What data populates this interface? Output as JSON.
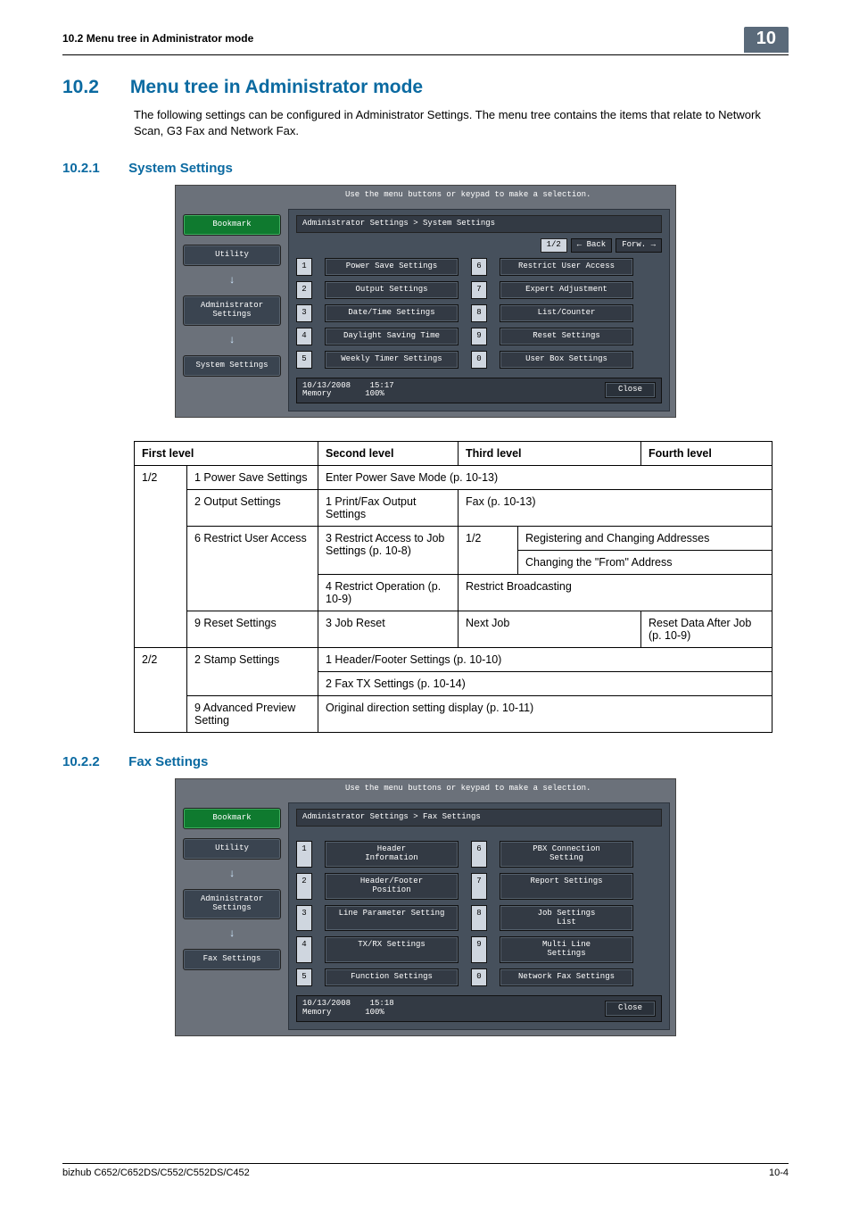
{
  "header": {
    "running_title": "10.2    Menu tree in Administrator mode",
    "chapter_badge": "10"
  },
  "section": {
    "number": "10.2",
    "title": "Menu tree in Administrator mode",
    "intro": "The following settings can be configured in Administrator Settings. The menu tree contains the items that relate to Network Scan, G3 Fax and Network Fax."
  },
  "sub1": {
    "number": "10.2.1",
    "title": "System Settings",
    "panel": {
      "hint": "Use the menu buttons or keypad to make a selection.",
      "side": {
        "bookmark": "Bookmark",
        "utility": "Utility",
        "admin": "Administrator\nSettings",
        "current": "System Settings"
      },
      "breadcrumb": "Administrator Settings > System Settings",
      "pager": {
        "page": "1/2",
        "back": "← Back",
        "fwd": "Forw. →"
      },
      "rows": [
        {
          "n1": "1",
          "l1": "Power Save Settings",
          "n2": "6",
          "l2": "Restrict User Access"
        },
        {
          "n1": "2",
          "l1": "Output Settings",
          "n2": "7",
          "l2": "Expert Adjustment"
        },
        {
          "n1": "3",
          "l1": "Date/Time Settings",
          "n2": "8",
          "l2": "List/Counter"
        },
        {
          "n1": "4",
          "l1": "Daylight Saving Time",
          "n2": "9",
          "l2": "Reset Settings"
        },
        {
          "n1": "5",
          "l1": "Weekly Timer Settings",
          "n2": "0",
          "l2": "User Box Settings"
        }
      ],
      "footer": {
        "date": "10/13/2008",
        "time": "15:17",
        "mem": "Memory",
        "pct": "100%",
        "close": "Close"
      }
    },
    "table": {
      "headers": {
        "c1": "First level",
        "c2": "Second level",
        "c3": "Third level",
        "c4": "Fourth level"
      },
      "r1": {
        "a": "1/2",
        "b": "1 Power Save Settings",
        "c": "Enter Power Save Mode (p. 10-13)"
      },
      "r2": {
        "b": "2 Output Settings",
        "c": "1 Print/Fax Output Settings",
        "d": "Fax (p. 10-13)"
      },
      "r3": {
        "b": "6 Restrict User Access",
        "c": "3 Restrict Access to Job Settings (p. 10-8)",
        "d": "1/2",
        "e1": "Registering and Changing Addresses",
        "e2": "Changing the \"From\" Address"
      },
      "r4": {
        "c": "4 Restrict Operation (p. 10-9)",
        "d": "Restrict Broadcasting"
      },
      "r5": {
        "b": "9 Reset Settings",
        "c": "3 Job Reset",
        "d": "Next Job",
        "e": "Reset Data After Job (p. 10-9)"
      },
      "r6": {
        "a": "2/2",
        "b": "2 Stamp Settings",
        "c1": "1 Header/Footer Settings (p. 10-10)",
        "c2": "2 Fax TX Settings (p. 10-14)"
      },
      "r7": {
        "b": "9 Advanced Preview Setting",
        "c": "Original direction setting display (p. 10-11)"
      }
    }
  },
  "sub2": {
    "number": "10.2.2",
    "title": "Fax Settings",
    "panel": {
      "hint": "Use the menu buttons or keypad to make a selection.",
      "side": {
        "bookmark": "Bookmark",
        "utility": "Utility",
        "admin": "Administrator\nSettings",
        "current": "Fax Settings"
      },
      "breadcrumb": "Administrator Settings  > Fax Settings",
      "rows": [
        {
          "n1": "1",
          "l1": "Header\nInformation",
          "n2": "6",
          "l2": "PBX Connection\nSetting"
        },
        {
          "n1": "2",
          "l1": "Header/Footer\nPosition",
          "n2": "7",
          "l2": "Report Settings"
        },
        {
          "n1": "3",
          "l1": "Line Parameter Setting",
          "n2": "8",
          "l2": "Job Settings\nList"
        },
        {
          "n1": "4",
          "l1": "TX/RX Settings",
          "n2": "9",
          "l2": "Multi Line\nSettings"
        },
        {
          "n1": "5",
          "l1": "Function Settings",
          "n2": "0",
          "l2": "Network Fax Settings"
        }
      ],
      "footer": {
        "date": "10/13/2008",
        "time": "15:18",
        "mem": "Memory",
        "pct": "100%",
        "close": "Close"
      }
    }
  },
  "footer": {
    "left": "bizhub C652/C652DS/C552/C552DS/C452",
    "right": "10-4"
  }
}
